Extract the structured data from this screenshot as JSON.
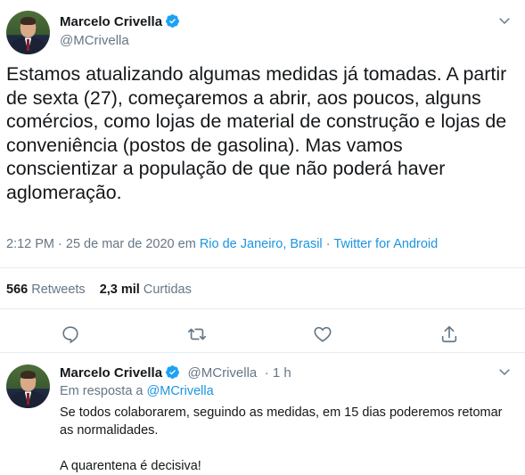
{
  "main_tweet": {
    "author_name": "Marcelo Crivella",
    "author_handle": "@MCrivella",
    "text": "Estamos atualizando algumas medidas já tomadas. A partir de sexta (27), começaremos a abrir, aos poucos, alguns comércios, como lojas de material de construção e lojas de conveniência (postos de gasolina). Mas vamos conscientizar a população de que não poderá haver aglomeração.",
    "time": "2:12 PM · 25 de mar de 2020 em",
    "location": "Rio de Janeiro, Brasil",
    "separator": "·",
    "client": "Twitter for Android",
    "retweets_count": "566",
    "retweets_label": "Retweets",
    "likes_count": "2,3 mil",
    "likes_label": "Curtidas",
    "actions": [
      "reply-icon",
      "retweet-icon",
      "like-icon",
      "share-icon"
    ]
  },
  "reply_tweet": {
    "author_name": "Marcelo Crivella",
    "author_handle": "@MCrivella",
    "age": "· 1 h",
    "reply_prefix": "Em resposta a",
    "reply_to_handle": "@MCrivella",
    "paragraph_1": "Se todos colaborarem, seguindo as medidas, em 15 dias poderemos retomar as normalidades.",
    "paragraph_2": "A quarentena é decisiva!"
  },
  "colors": {
    "accent": "#1b95e0",
    "secondary_text": "#657786",
    "primary_text": "#14171a",
    "divider": "#e6ecf0"
  }
}
